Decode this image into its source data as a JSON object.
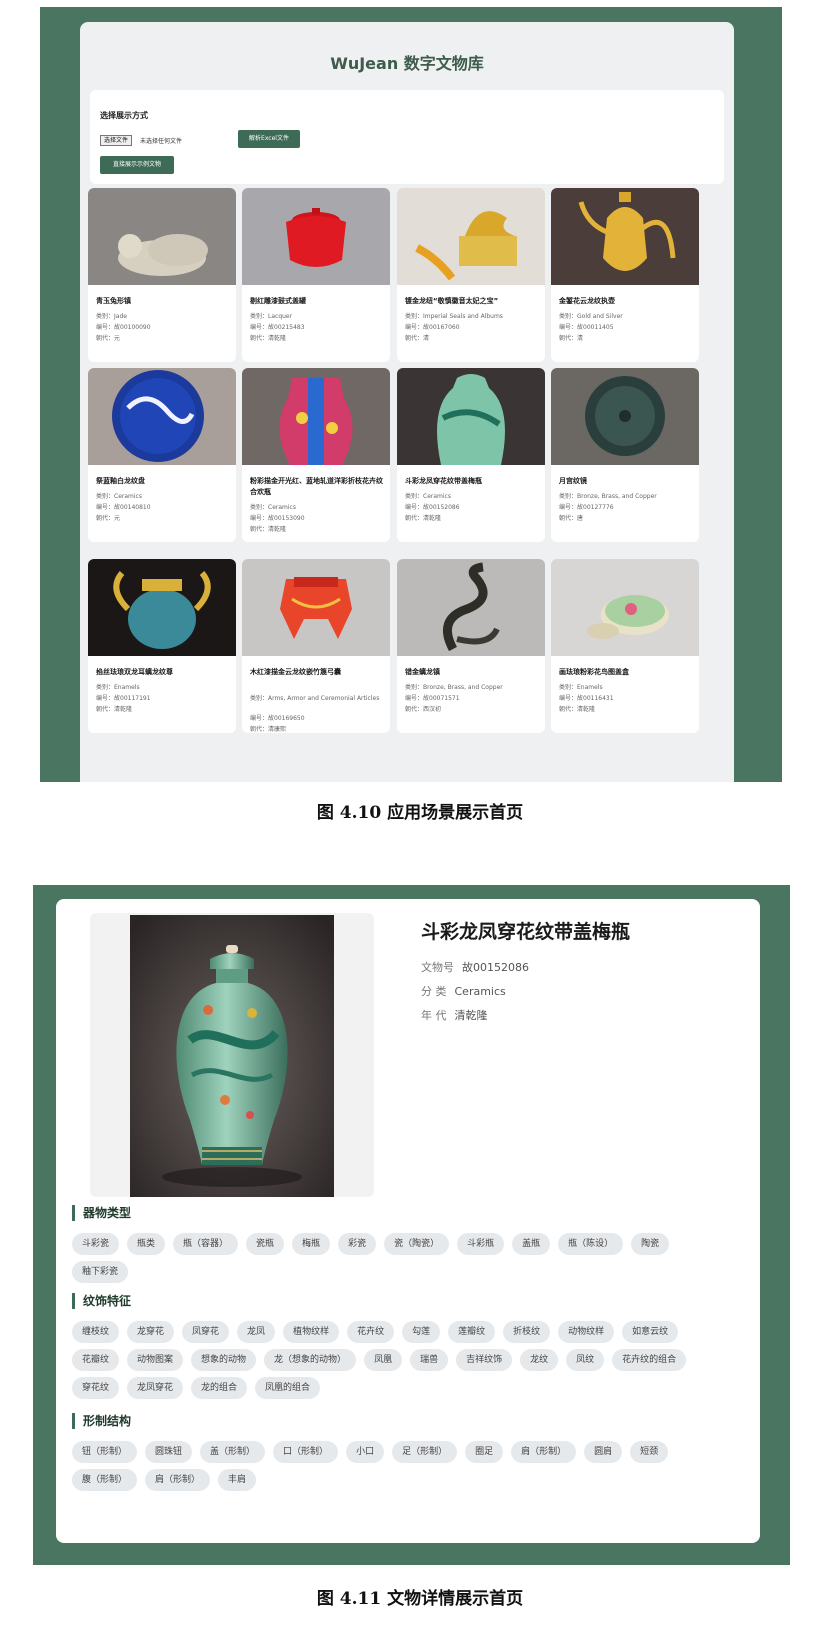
{
  "figure_1": {
    "app_title": "WuJean 数字文物库",
    "selector_label": "选择展示方式",
    "file_button": "选择文件",
    "file_status": "未选择任何文件",
    "excel_button": "解析Excel文件",
    "random_button": "直接展示示例文物",
    "cards": [
      {
        "title": "青玉兔形镇",
        "category": "类别：Jade",
        "number": "编号：故00100090",
        "era": "朝代：元",
        "thumb": "jade-rabbit"
      },
      {
        "title": "剔红雕漆鼓式盖罐",
        "category": "类别：Lacquer",
        "number": "编号：故00215483",
        "era": "朝代：清乾隆",
        "thumb": "red-lacquer-jar"
      },
      {
        "title": "镀金龙纽“敬慎徽音太妃之宝”",
        "category": "类别：Imperial Seals and Albums",
        "number": "编号：故00167060",
        "era": "朝代：清",
        "thumb": "gold-dragon-seal"
      },
      {
        "title": "金錾花云龙纹执壶",
        "category": "类别：Gold and Silver",
        "number": "编号：故00011405",
        "era": "朝代：清",
        "thumb": "gold-ewer"
      },
      {
        "title": "祭蓝釉白龙纹盘",
        "category": "类别：Ceramics",
        "number": "编号：故00140810",
        "era": "朝代：元",
        "thumb": "blue-dragon-plate"
      },
      {
        "title": "粉彩描金开光红、蓝地轧道洋彩折枝花卉纹合欢瓶",
        "category": "类别：Ceramics",
        "number": "编号：故00153090",
        "era": "朝代：清乾隆",
        "thumb": "famille-rose-vase"
      },
      {
        "title": "斗彩龙凤穿花纹带盖梅瓶",
        "category": "类别：Ceramics",
        "number": "编号：故00152086",
        "era": "朝代：清乾隆",
        "thumb": "green-meiping"
      },
      {
        "title": "月宫纹镜",
        "category": "类别：Bronze, Brass, and Copper",
        "number": "编号：故00127776",
        "era": "朝代：唐",
        "thumb": "bronze-mirror"
      },
      {
        "title": "掐丝珐琅双龙耳螭龙纹尊",
        "category": "类别：Enamels",
        "number": "编号：故00117191",
        "era": "朝代：清乾隆",
        "thumb": "enamel-dragon-vessel"
      },
      {
        "title": "木红漆描金云龙纹嵌竹篾弓囊",
        "category": "类别：Arms, Armor and Ceremonial Articles",
        "number": "编号：故00169650",
        "era": "朝代：清康熙",
        "thumb": "red-gold-quiver"
      },
      {
        "title": "错金螭龙镇",
        "category": "类别：Bronze, Brass, and Copper",
        "number": "编号：故00071571",
        "era": "朝代：西汉初",
        "thumb": "bronze-chilong"
      },
      {
        "title": "画珐琅粉彩花鸟图盖盒",
        "category": "类别：Enamels",
        "number": "编号：故00116431",
        "era": "朝代：清乾隆",
        "thumb": "enamel-box"
      }
    ]
  },
  "caption_1": "图 4.10  应用场景展示首页",
  "figure_2": {
    "title": "斗彩龙凤穿花纹带盖梅瓶",
    "rows": [
      {
        "label": "文物号",
        "value": "故00152086"
      },
      {
        "label": "分 类",
        "value": "Ceramics"
      },
      {
        "label": "年 代",
        "value": "清乾隆"
      }
    ],
    "sections": [
      {
        "heading": "器物类型",
        "tags": [
          "斗彩瓷",
          "瓶类",
          "瓶（容器）",
          "瓷瓶",
          "梅瓶",
          "彩瓷",
          "瓷（陶瓷）",
          "斗彩瓶",
          "盖瓶",
          "瓶（陈设）",
          "陶瓷",
          "釉下彩瓷"
        ]
      },
      {
        "heading": "纹饰特征",
        "tags": [
          "缠枝纹",
          "龙穿花",
          "凤穿花",
          "龙凤",
          "植物纹样",
          "花卉纹",
          "勾莲",
          "莲瓣纹",
          "折枝纹",
          "动物纹样",
          "如意云纹",
          "花瓣纹",
          "动物图案",
          "想象的动物",
          "龙（想象的动物）",
          "凤凰",
          "瑞兽",
          "吉祥纹饰",
          "龙纹",
          "凤纹",
          "花卉纹的组合",
          "穿花纹",
          "龙凤穿花",
          "龙的组合",
          "凤凰的组合"
        ]
      },
      {
        "heading": "形制结构",
        "tags": [
          "钮（形制）",
          "圆珠钮",
          "盖（形制）",
          "口（形制）",
          "小口",
          "足（形制）",
          "圈足",
          "肩（形制）",
          "圆肩",
          "短颈",
          "腹（形制）",
          "肩（形制）",
          "丰肩"
        ]
      }
    ]
  },
  "caption_2": "图 4.11  文物详情展示首页"
}
